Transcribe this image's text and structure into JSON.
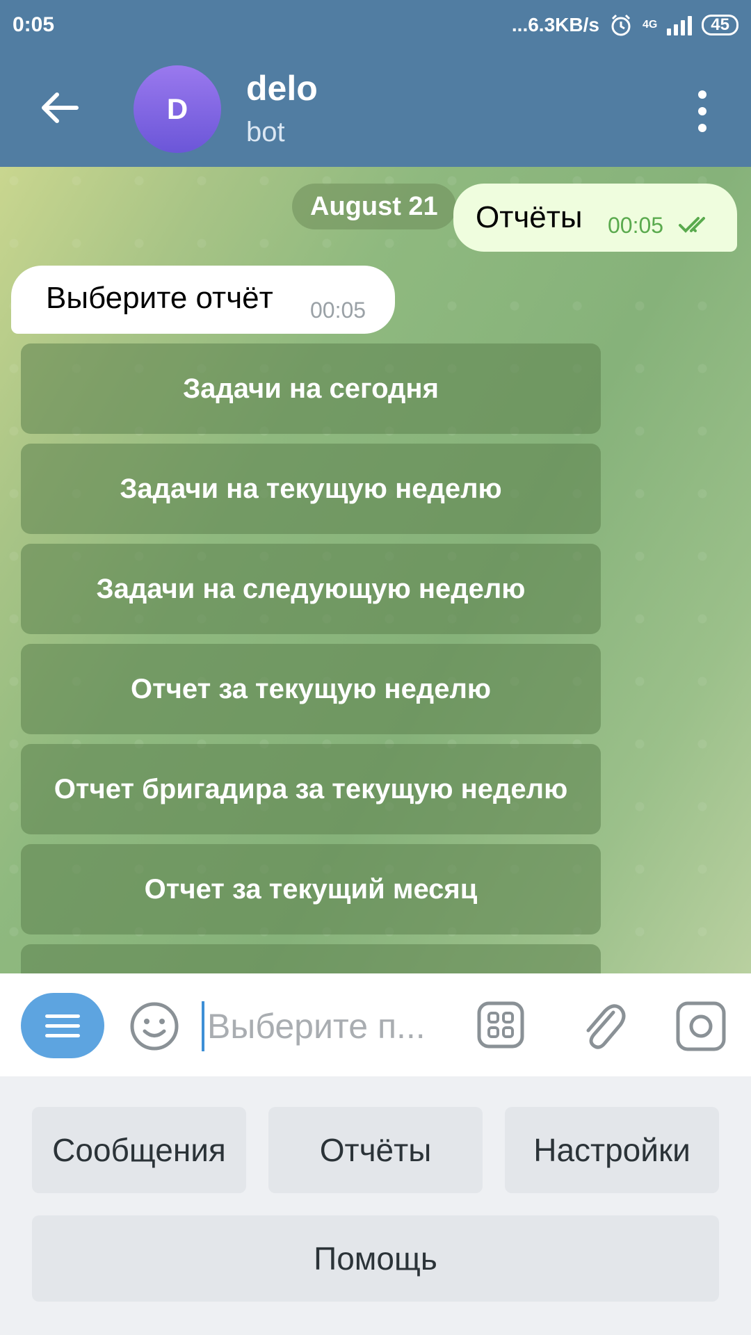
{
  "status_bar": {
    "time": "0:05",
    "network_speed": "...6.3KB/s",
    "network_type": "4G",
    "battery": "45"
  },
  "header": {
    "avatar_letter": "D",
    "title": "delo",
    "subtitle": "bot"
  },
  "chat": {
    "date_label": "August 21",
    "outgoing_message": {
      "text": "Отчёты",
      "time": "00:05",
      "status": "read"
    },
    "incoming_message": {
      "text": "Выберите отчёт",
      "time": "00:05"
    },
    "inline_buttons": [
      "Задачи на сегодня",
      "Задачи на текущую неделю",
      "Задачи на следующую неделю",
      "Отчет за текущую неделю",
      "Отчет бригадира за текущую неделю",
      "Отчет за текущий месяц",
      ""
    ]
  },
  "input_bar": {
    "placeholder": "Выберите п..."
  },
  "reply_keyboard": {
    "row1": [
      "Сообщения",
      "Отчёты",
      "Настройки"
    ],
    "row2": [
      "Помощь"
    ]
  },
  "colors": {
    "header": "#517da2",
    "outgoing_bubble": "#effdde",
    "incoming_bubble": "#ffffff",
    "accent": "#5da4e0"
  }
}
